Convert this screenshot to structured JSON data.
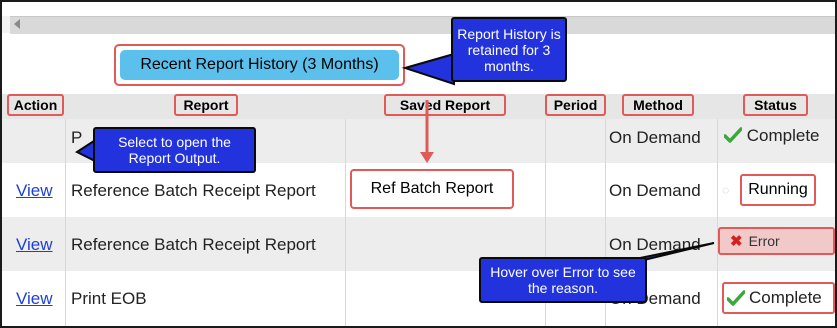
{
  "history_button": {
    "label": "Recent Report History (3 Months)"
  },
  "callouts": {
    "retention": "Report History is retained for 3 months.",
    "open_output": "Select to open the Report Output.",
    "hover_error": "Hover over Error to see the reason."
  },
  "table": {
    "headers": [
      "Action",
      "Report",
      "Saved Report",
      "Period",
      "Method",
      "Status"
    ],
    "rows": [
      {
        "action": "",
        "report": "P",
        "saved_report": "",
        "period": "",
        "method": "On Demand",
        "status": "Complete"
      },
      {
        "action": "View",
        "report": "Reference Batch Receipt Report",
        "saved_report": "Ref Batch Report",
        "period": "",
        "method": "On Demand",
        "status": "Running"
      },
      {
        "action": "View",
        "report": "Reference Batch Receipt Report",
        "saved_report": "",
        "period": "",
        "method": "On Demand",
        "status": "Error"
      },
      {
        "action": "View",
        "report": "Print EOB",
        "saved_report": "",
        "period": "",
        "method": "On Demand",
        "status": "Complete"
      }
    ]
  },
  "colors": {
    "callout_bg": "#2233dd",
    "highlight_border": "#e05a5a",
    "button_bg": "#5bc0eb",
    "link": "#1d3fd6",
    "check": "#3aa83a",
    "error_x": "#d42020",
    "error_bg": "#f2c9c9"
  },
  "icons": [
    "scroll-left-arrow-icon",
    "checkmark-icon",
    "error-x-icon",
    "spinner-icon"
  ]
}
